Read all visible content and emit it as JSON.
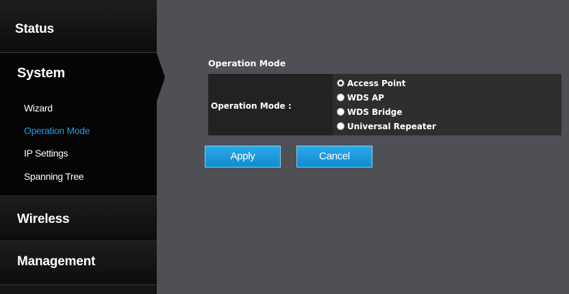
{
  "sidebar": {
    "sections": {
      "status": "Status",
      "system": "System",
      "wireless": "Wireless",
      "management": "Management"
    },
    "system_items": [
      "Wizard",
      "Operation Mode",
      "IP Settings",
      "Spanning Tree"
    ],
    "active_item": "Operation Mode"
  },
  "main": {
    "section_title": "Operation Mode",
    "field_label": "Operation Mode :",
    "options": [
      "Access Point",
      "WDS AP",
      "WDS Bridge",
      "Universal Repeater"
    ],
    "selected_option": "Access Point",
    "apply_label": "Apply",
    "cancel_label": "Cancel"
  },
  "colors": {
    "accent": "#1e9ce0",
    "background": "#4e5055",
    "sidebar": "#111111"
  }
}
